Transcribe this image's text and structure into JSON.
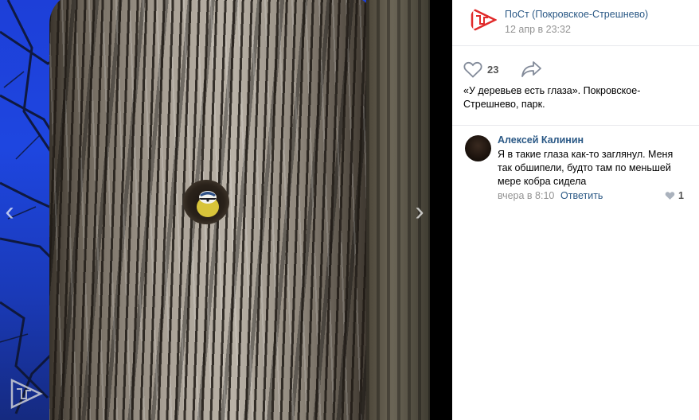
{
  "post": {
    "author": "ПоСт (Покровское-Стрешнево)",
    "date": "12 апр в 23:32",
    "likes": "23",
    "text": "«У деревьев есть глаза». Покровское-Стрешнево, парк."
  },
  "comment": {
    "author": "Алексей Калинин",
    "text": "Я в такие глаза как-то заглянул. Меня так обшипели, будто там по меньшей мере кобра сидела",
    "date": "вчера в 8:10",
    "reply_label": "Ответить",
    "likes": "1"
  },
  "viewer": {
    "prev_glyph": "‹",
    "next_glyph": "›"
  },
  "icons": {
    "like": "heart-icon",
    "share": "share-arrow-icon",
    "brand_logo": "post-logo-icon"
  },
  "colors": {
    "link": "#2a5885",
    "muted": "#939393",
    "brand_red": "#e12a2a",
    "sky": "#1e46e0"
  }
}
